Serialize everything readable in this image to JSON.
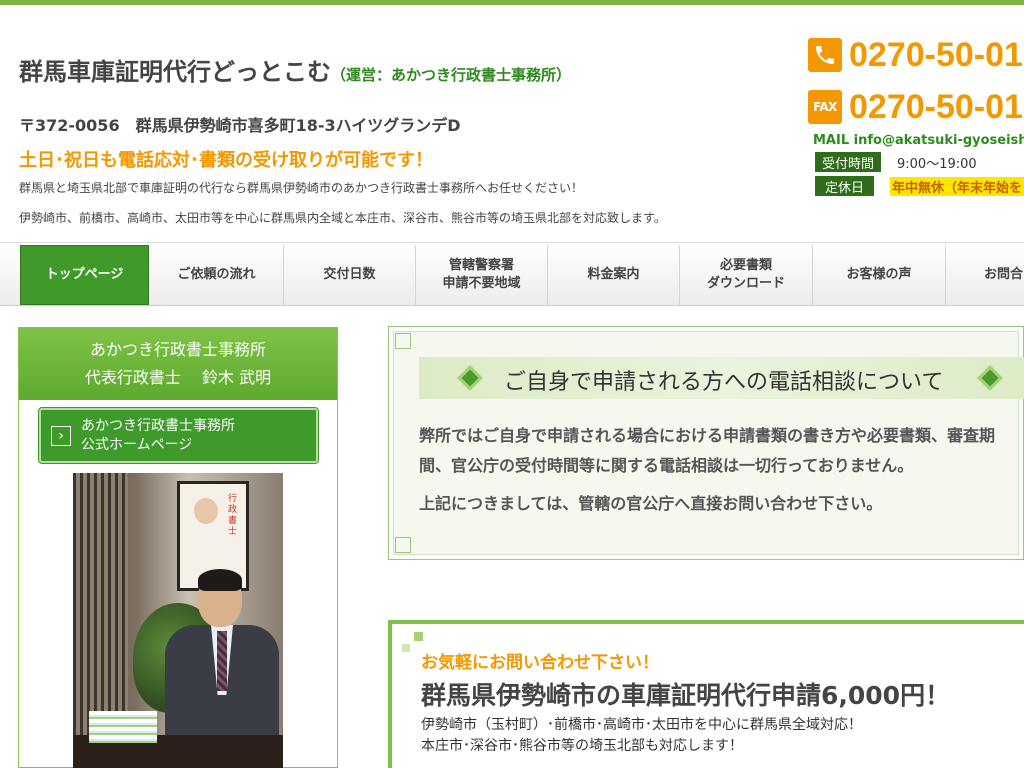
{
  "header": {
    "site_title": "群馬車庫証明代行どっとこむ",
    "operator": "（運営：あかつき行政書士事務所）",
    "address": "〒372-0056　群馬県伊勢崎市喜多町18-3ハイツグランデD",
    "catch_copy": "土日･祝日も電話応対･書類の受け取りが可能です！",
    "description_1": "群馬県と埼玉県北部で車庫証明の代行なら群馬県伊勢崎市のあかつき行政書士事務所へお任せください！",
    "description_2": "伊勢崎市、前橋市、高崎市、太田市等を中心に群馬県内全域と本庄市、深谷市、熊谷市等の埼玉県北部を対応致します。"
  },
  "contact": {
    "fax_icon_label": "FAX",
    "tel": "0270-50-01",
    "fax": "0270-50-01",
    "mail": "MAIL info@akatsuki-gyoseishos",
    "hours_label": "受付時間",
    "hours": "9:00〜19:00",
    "holiday_label": "定休日",
    "holiday": "年中無休（年末年始を"
  },
  "nav": {
    "items": [
      {
        "label": "トップページ"
      },
      {
        "label": "ご依頼の流れ"
      },
      {
        "label": "交付日数"
      },
      {
        "label_1": "管轄警察署",
        "label_2": "申請不要地域"
      },
      {
        "label": "料金案内"
      },
      {
        "label_1": "必要書類",
        "label_2": "ダウンロード"
      },
      {
        "label": "お客様の声"
      },
      {
        "label": "お問合"
      }
    ]
  },
  "sidebar": {
    "office": "あかつき行政書士事務所",
    "representative": "代表行政書士　 鈴木 武明",
    "link_line1": "あかつき行政書士事務所",
    "link_line2": "公式ホームページ",
    "link_arrow": "›",
    "poster_text": "行政書士"
  },
  "notice": {
    "title": "ご自身で申請される方への電話相談について",
    "body_1": "弊所ではご自身で申請される場合における申請書類の書き方や必要書類、審査期",
    "body_2": "間、官公庁の受付時間等に関する電話相談は一切行っておりません。",
    "body_3": "上記につきましては、管轄の官公庁へ直接お問い合わせ下さい。"
  },
  "promo": {
    "lead": "お気軽にお問い合わせ下さい！",
    "title": "群馬県伊勢崎市の車庫証明代行申請6,000円！",
    "area_1": "伊勢崎市（玉村町）･前橋市･高崎市･太田市を中心に群馬県全域対応！",
    "area_2": "本庄市･深谷市･熊谷市等の埼玉北部も対応します！"
  },
  "colors": {
    "brand_green": "#3f9a2a",
    "accent_orange": "#f39800",
    "holiday_highlight": "#ffe600"
  }
}
